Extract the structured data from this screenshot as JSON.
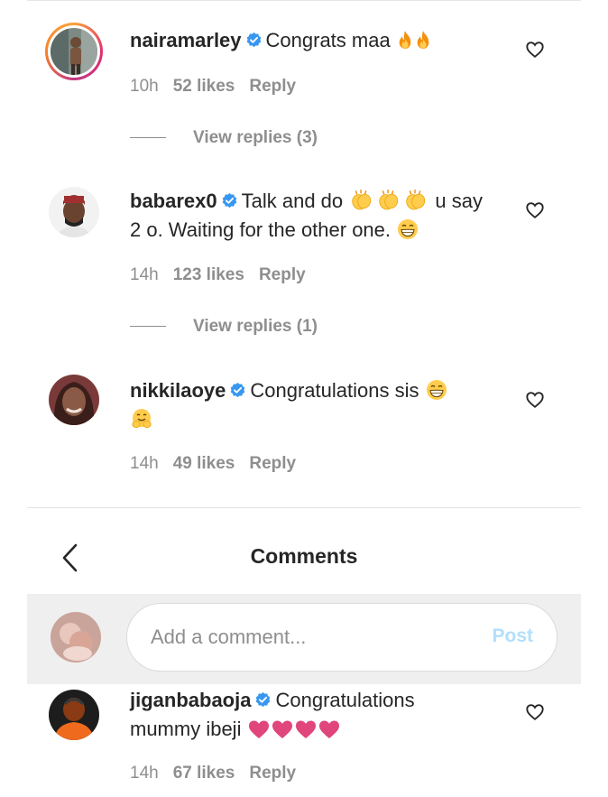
{
  "comments_top": [
    {
      "username": "nairamarley",
      "text": "Congrats maa",
      "time": "10h",
      "likes": "52 likes",
      "reply": "Reply",
      "view_replies": "View replies (3)"
    },
    {
      "username": "babarex0",
      "text_a": "Talk and do",
      "text_b": "u say",
      "text_c": "2 o. Waiting for the other one.",
      "time": "14h",
      "likes": "123 likes",
      "reply": "Reply",
      "view_replies": "View replies (1)"
    },
    {
      "username": "nikkilaoye",
      "text": "Congratulations sis",
      "time": "14h",
      "likes": "49 likes",
      "reply": "Reply"
    }
  ],
  "header": {
    "title": "Comments"
  },
  "composer": {
    "placeholder": "Add a comment...",
    "post_label": "Post"
  },
  "comments_bottom": [
    {
      "username": "jiganbabaoja",
      "text_a": "Congratulations",
      "text_b": "mummy ibeji",
      "time": "14h",
      "likes": "67 likes",
      "reply": "Reply"
    }
  ],
  "colors": {
    "verified": "#3897f0",
    "heart_pink": "#e0457b",
    "post_disabled": "#b2dffc",
    "composer_bg": "#efefef"
  },
  "icons": [
    "verified-badge-icon",
    "heart-outline-icon",
    "fire-emoji-icon",
    "clap-emoji-icon",
    "grin-emoji-icon",
    "hug-emoji-icon",
    "pink-heart-emoji-icon",
    "back-chevron-icon"
  ]
}
